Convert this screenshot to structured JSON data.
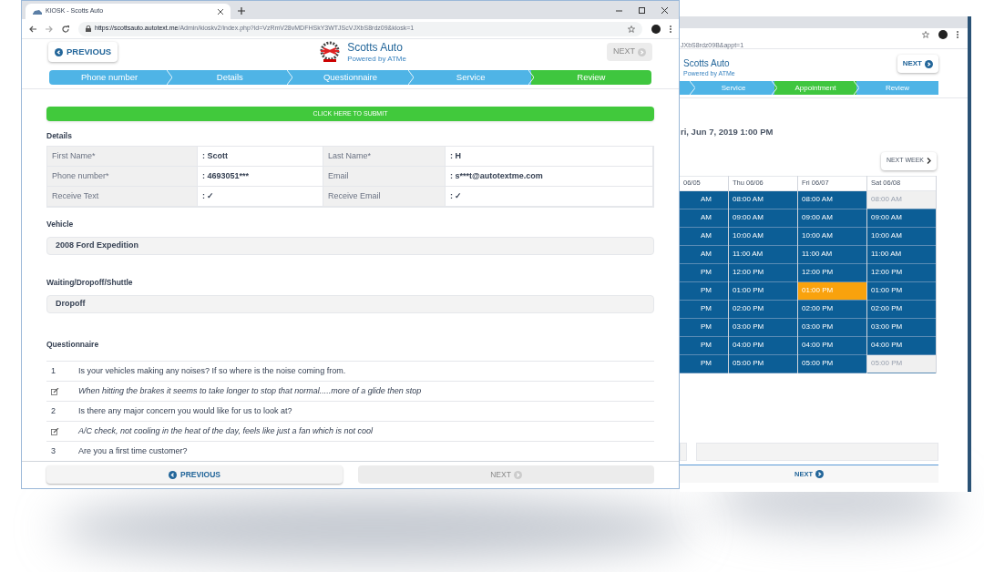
{
  "front_window": {
    "tab_title": "KIOSK - Scotts Auto",
    "url_host": "https://scottsauto.autotext.me",
    "url_path": "/Admin/kioskv2/index.php?id=VzRmV28vMDFHSkY3WTJScVJXbS8rdz09&kiosk=1",
    "header": {
      "previous": "PREVIOUS",
      "brand": "Scotts Auto",
      "tagline": "Powered by ATMe",
      "next": "NEXT",
      "next_disabled": true
    },
    "steps": [
      {
        "label": "Phone number",
        "selected": false
      },
      {
        "label": "Details",
        "selected": false
      },
      {
        "label": "Questionnaire",
        "selected": false
      },
      {
        "label": "Service",
        "selected": false
      },
      {
        "label": "Review",
        "selected": true
      }
    ],
    "submit": "CLICK HERE TO SUBMIT",
    "details": {
      "title": "Details",
      "rows": [
        [
          "First Name*",
          ": Scott",
          "Last Name*",
          ": H"
        ],
        [
          "Phone number*",
          ": 4693051***",
          "Email",
          ": s***t@autotextme.com"
        ],
        [
          "Receive Text",
          ": ✓",
          "Receive Email",
          ": ✓"
        ]
      ]
    },
    "vehicle": {
      "label": "Vehicle",
      "value": "2008 Ford Expedition"
    },
    "waiting": {
      "label": "Waiting/Dropoff/Shuttle",
      "value": "Dropoff"
    },
    "questionnaire": {
      "title": "Questionnaire",
      "rows": [
        {
          "kind": "question",
          "number": "1",
          "text": "Is your vehicles making any noises? If so where is the noise coming from."
        },
        {
          "kind": "answer",
          "text": "When hitting the brakes it seems to take longer to stop that normal.....more of a glide then stop"
        },
        {
          "kind": "question",
          "number": "2",
          "text": "Is there any major concern you would like for us to look at?"
        },
        {
          "kind": "answer",
          "text": "A/C check, not cooling in the heat of the day, feels like just a fan which is not cool"
        },
        {
          "kind": "question",
          "number": "3",
          "text": "Are you a first time customer?"
        }
      ]
    },
    "footer": {
      "previous": "PREVIOUS",
      "next": "NEXT",
      "next_disabled": true
    }
  },
  "back_window": {
    "url_fragment": "JXbS8rdz09B&appt=1",
    "brand": "Scotts Auto",
    "tagline": "Powered by ATMe",
    "next": "NEXT",
    "steps": [
      {
        "label": "Service",
        "selected": false
      },
      {
        "label": "Appointment",
        "selected": true
      },
      {
        "label": "Review",
        "selected": false
      }
    ],
    "chosen_time": "ri, Jun 7, 2019 1:00 PM",
    "next_week": "NEXT WEEK",
    "days": [
      {
        "header": "06/05",
        "slots": [
          {
            "time": "AM",
            "selected": false,
            "disabled": false
          },
          {
            "time": "AM",
            "selected": false,
            "disabled": false
          },
          {
            "time": "AM",
            "selected": false,
            "disabled": false
          },
          {
            "time": "AM",
            "selected": false,
            "disabled": false
          },
          {
            "time": "PM",
            "selected": false,
            "disabled": false
          },
          {
            "time": "PM",
            "selected": false,
            "disabled": false
          },
          {
            "time": "PM",
            "selected": false,
            "disabled": false
          },
          {
            "time": "PM",
            "selected": false,
            "disabled": false
          },
          {
            "time": "PM",
            "selected": false,
            "disabled": false
          },
          {
            "time": "PM",
            "selected": false,
            "disabled": false
          }
        ]
      },
      {
        "header": "Thu 06/06",
        "slots": [
          {
            "time": "08:00 AM",
            "selected": false,
            "disabled": false
          },
          {
            "time": "09:00 AM",
            "selected": false,
            "disabled": false
          },
          {
            "time": "10:00 AM",
            "selected": false,
            "disabled": false
          },
          {
            "time": "11:00 AM",
            "selected": false,
            "disabled": false
          },
          {
            "time": "12:00 PM",
            "selected": false,
            "disabled": false
          },
          {
            "time": "01:00 PM",
            "selected": false,
            "disabled": false
          },
          {
            "time": "02:00 PM",
            "selected": false,
            "disabled": false
          },
          {
            "time": "03:00 PM",
            "selected": false,
            "disabled": false
          },
          {
            "time": "04:00 PM",
            "selected": false,
            "disabled": false
          },
          {
            "time": "05:00 PM",
            "selected": false,
            "disabled": false
          }
        ]
      },
      {
        "header": "Fri 06/07",
        "slots": [
          {
            "time": "08:00 AM",
            "selected": false,
            "disabled": false
          },
          {
            "time": "09:00 AM",
            "selected": false,
            "disabled": false
          },
          {
            "time": "10:00 AM",
            "selected": false,
            "disabled": false
          },
          {
            "time": "11:00 AM",
            "selected": false,
            "disabled": false
          },
          {
            "time": "12:00 PM",
            "selected": false,
            "disabled": false
          },
          {
            "time": "01:00 PM",
            "selected": true,
            "disabled": false
          },
          {
            "time": "02:00 PM",
            "selected": false,
            "disabled": false
          },
          {
            "time": "03:00 PM",
            "selected": false,
            "disabled": false
          },
          {
            "time": "04:00 PM",
            "selected": false,
            "disabled": false
          },
          {
            "time": "05:00 PM",
            "selected": false,
            "disabled": false
          }
        ]
      },
      {
        "header": "Sat 06/08",
        "slots": [
          {
            "time": "08:00 AM",
            "selected": false,
            "disabled": true
          },
          {
            "time": "09:00 AM",
            "selected": false,
            "disabled": false
          },
          {
            "time": "10:00 AM",
            "selected": false,
            "disabled": false
          },
          {
            "time": "11:00 AM",
            "selected": false,
            "disabled": false
          },
          {
            "time": "12:00 PM",
            "selected": false,
            "disabled": false
          },
          {
            "time": "01:00 PM",
            "selected": false,
            "disabled": false
          },
          {
            "time": "02:00 PM",
            "selected": false,
            "disabled": false
          },
          {
            "time": "03:00 PM",
            "selected": false,
            "disabled": false
          },
          {
            "time": "04:00 PM",
            "selected": false,
            "disabled": false
          },
          {
            "time": "05:00 PM",
            "selected": false,
            "disabled": true
          }
        ]
      }
    ],
    "footer_next": "NEXT"
  }
}
